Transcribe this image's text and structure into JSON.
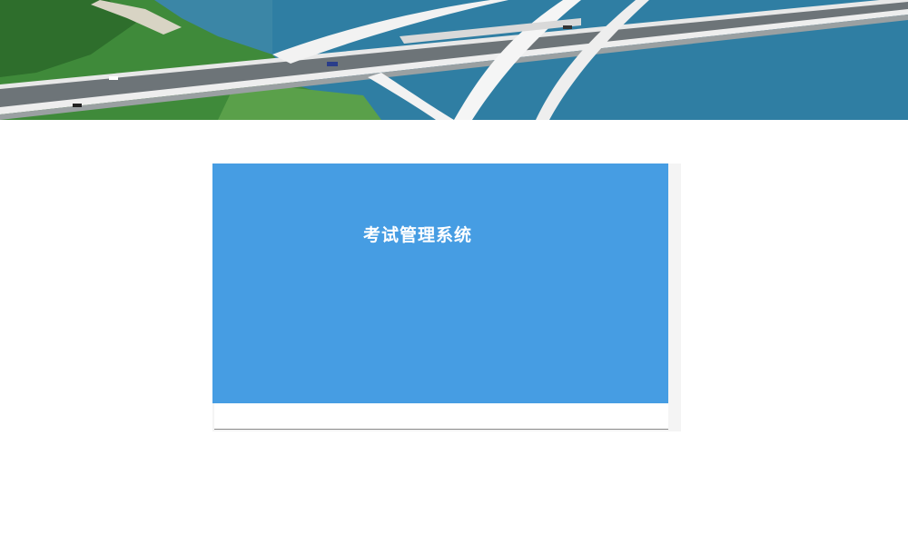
{
  "banner": {
    "image": "bridge-over-river-photo"
  },
  "login_panel": {
    "title": "考试管理系统",
    "background_color": "#469de3"
  }
}
